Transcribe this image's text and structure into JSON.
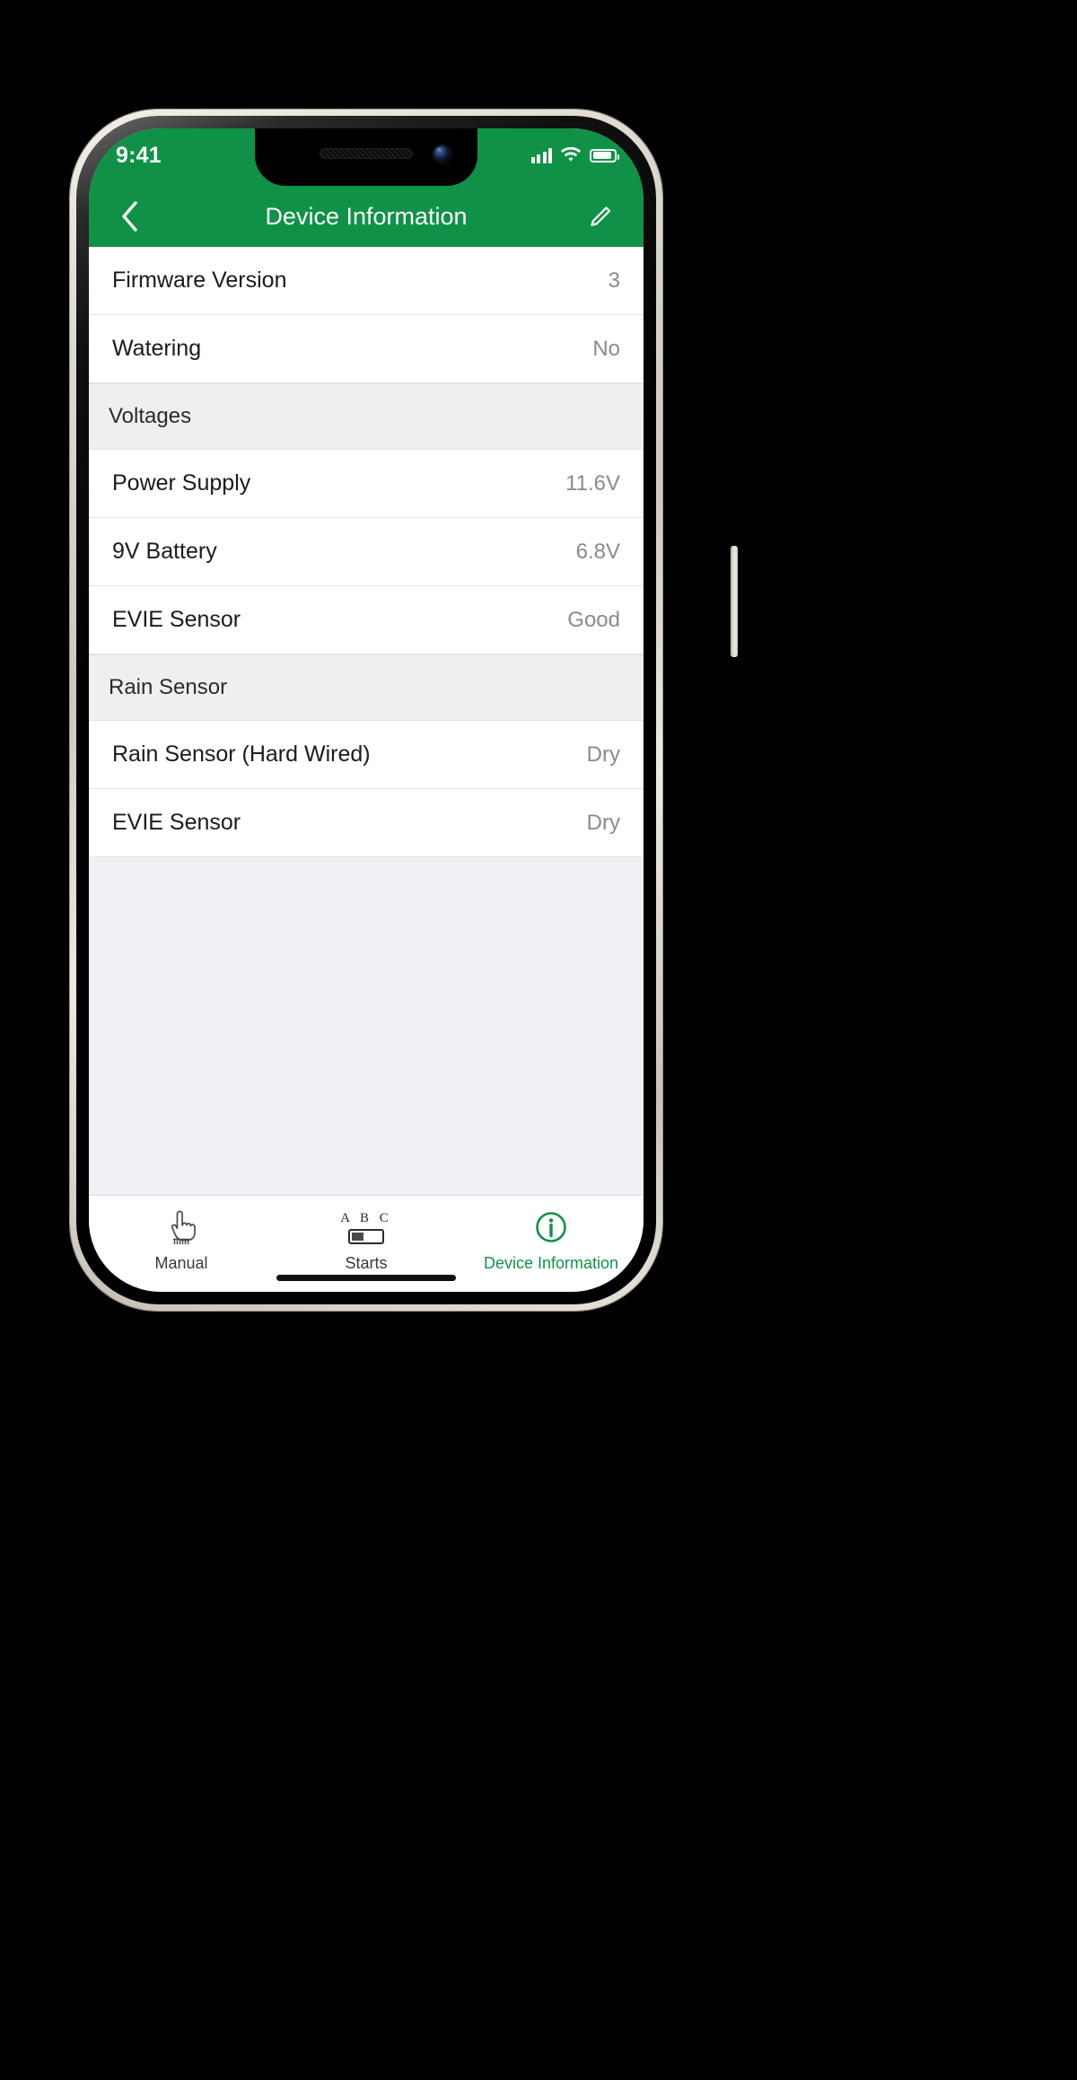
{
  "status_bar": {
    "time": "9:41",
    "signal_icon": "cellular-bars-icon",
    "wifi_icon": "wifi-icon",
    "battery_icon": "battery-icon"
  },
  "nav": {
    "back_icon": "chevron-left-icon",
    "title": "Device Information",
    "edit_icon": "pencil-icon"
  },
  "theme": {
    "brand_green": "#0f9247",
    "value_gray": "#8a8a8f",
    "section_bg": "#efeff0",
    "page_bg": "#efeff4"
  },
  "list": [
    {
      "kind": "row",
      "label": "Firmware Version",
      "value": "3"
    },
    {
      "kind": "row",
      "label": "Watering",
      "value": "No"
    },
    {
      "kind": "header",
      "label": "Voltages",
      "value": ""
    },
    {
      "kind": "row",
      "label": "Power Supply",
      "value": "11.6V"
    },
    {
      "kind": "row",
      "label": "9V Battery",
      "value": "6.8V"
    },
    {
      "kind": "row",
      "label": "EVIE Sensor",
      "value": "Good"
    },
    {
      "kind": "header",
      "label": "Rain Sensor",
      "value": ""
    },
    {
      "kind": "row",
      "label": "Rain Sensor (Hard Wired)",
      "value": "Dry"
    },
    {
      "kind": "row",
      "label": "EVIE Sensor",
      "value": "Dry"
    }
  ],
  "tabs": [
    {
      "label": "Manual",
      "icon": "pointing-hand-icon",
      "active": false
    },
    {
      "label": "Starts",
      "icon": "abc-switch-icon",
      "active": false
    },
    {
      "label": "Device Information",
      "icon": "info-circle-icon",
      "active": true
    }
  ]
}
